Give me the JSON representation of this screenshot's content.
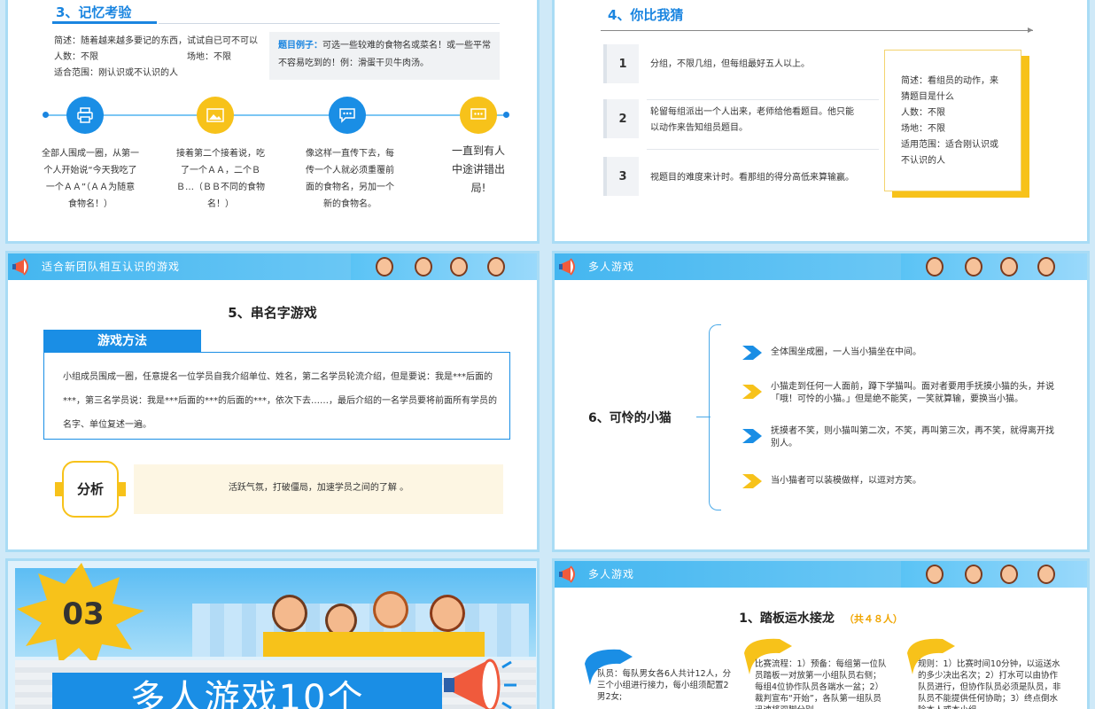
{
  "s1": {
    "title": "3、记忆考验",
    "desc": "简述：随着越来越多要记的东西，试试自已可不可以",
    "people": "人数：不限",
    "venue": "场地：不限",
    "scope": "适合范围：刚认识或不认识的人",
    "example_label": "题目例子：",
    "example_text": "可选一些较难的食物名或菜名！或一些平常不容易吃到的！例：滑蛋干贝牛肉汤。",
    "steps": [
      "全部人围成一圈，从第一个人开始说“今天我吃了一个ＡＡ”（ＡＡ为随意食物名！）",
      "接着第二个接着说，吃了一个ＡＡ，二个ＢＢ…（ＢＢ不同的食物名！）",
      "像这样一直传下去，每传一个人就必须重覆前面的食物名，另加一个新的食物名。",
      "一直到有人中途讲错出局!"
    ]
  },
  "s2": {
    "title": "4、你比我猜",
    "items": [
      {
        "num": "1",
        "text": "分组，不限几组，但每组最好五人以上。"
      },
      {
        "num": "2",
        "text": "轮留每组派出一个人出来，老师给他看题目。他只能以动作来告知组员题目。"
      },
      {
        "num": "3",
        "text": "视题目的难度来计时。看那组的得分高低来算输赢。"
      }
    ],
    "card": {
      "desc": "简述：看组员的动作，来猜题目是什么",
      "people": "人数：不限",
      "venue": "场地：不限",
      "scope": "适用范围：适合刚认识或不认识的人"
    }
  },
  "s3": {
    "banner": "适合新团队相互认识的游戏",
    "title": "5、串名字游戏",
    "method_label": "游戏方法",
    "method_text": "小组成员围成一圈，任意提名一位学员自我介绍单位、姓名，第二名学员轮流介绍，但是要说：我是***后面的***，第三名学员说：我是***后面的***的后面的***，依次下去……，最后介绍的一名学员要将前面所有学员的名字、单位复述一遍。",
    "analysis_label": "分析",
    "analysis_text": "活跃气氛，打破僵局，加速学员之间的了解 。"
  },
  "s4": {
    "banner": "多人游戏",
    "title": "6、可怜的小猫",
    "items": [
      "全体围坐成圈，一人当小猫坐在中间。",
      "小猫走到任何一人面前，蹲下学猫叫。面对者要用手抚摸小猫的头，并说「哦！可怜的小猫。」但是绝不能笑，一笑就算输，要换当小猫。",
      "抚摸者不笑，则小猫叫第二次，不笑，再叫第三次，再不笑，就得离开找别人。",
      "当小猫者可以装模做样，以逗对方笑。"
    ]
  },
  "s5": {
    "number": "03",
    "title": "多人游戏10个"
  },
  "s6": {
    "banner": "多人游戏",
    "title": "1、踏板运水接龙",
    "subtitle": "（共４８人）",
    "cols": [
      "队员：每队男女各6人共计12人，分三个小组进行接力，每小组须配置2男2女;",
      "比赛流程：1）预备：每组第一位队员踏板一对放第一小组队员右侧；每组4位协作队员各端水一盆；2）裁判宣布“开始”，各队第一组队员迅速将双脚分别",
      "规则：1）比赛时间10分钟，以运送水的多少决出名次；2）打水可以由协作队员进行，但协作队员必须是队员，非队员不能提供任何协助；3）终点倒水除本人或本小组"
    ]
  }
}
